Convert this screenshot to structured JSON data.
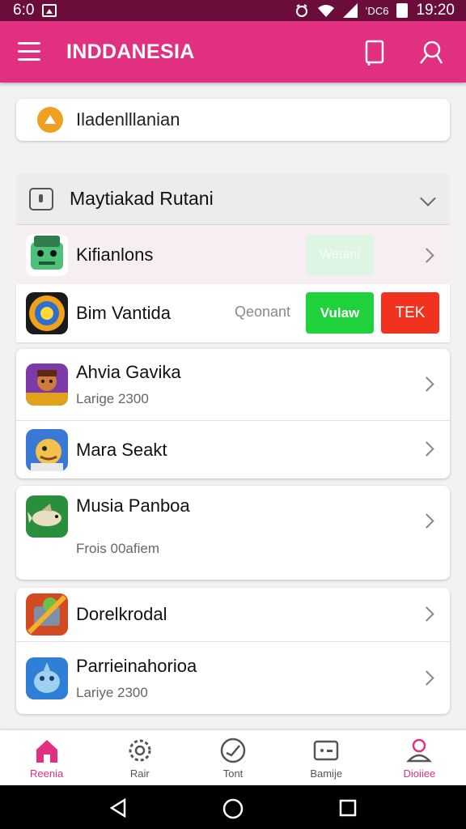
{
  "status_bar": {
    "time_left": "6:0",
    "network": "ʻDC6",
    "time": "19:20"
  },
  "app_bar": {
    "title": "INDDANESIA"
  },
  "search": {
    "text": "Iladenlllanian"
  },
  "section": {
    "title": "Maytiakad Rutani"
  },
  "swipe_rows": [
    {
      "name": "Kifianlons",
      "action": "Wetani"
    },
    {
      "name": "Bim Vantida",
      "swipe_label": "Qeonant",
      "accept": "Vulaw",
      "reject": "TEK"
    }
  ],
  "groups": [
    [
      {
        "name": "Ahvia Gavika",
        "sub": "Larige 2300"
      },
      {
        "name": "Mara Seakt",
        "sub": ""
      }
    ],
    [
      {
        "name": "Musia Panboa",
        "sub": "Frois 00afiem"
      }
    ],
    [
      {
        "name": "Dorelkrodal",
        "sub": ""
      },
      {
        "name": "Parrieinahorioa",
        "sub": "Lariye 2300"
      }
    ]
  ],
  "bottom_nav": [
    {
      "label": "Reenia",
      "icon": "home-icon",
      "active": true
    },
    {
      "label": "Rair",
      "icon": "gear-icon",
      "active": false
    },
    {
      "label": "Tont",
      "icon": "timer-icon",
      "active": false
    },
    {
      "label": "Bamije",
      "icon": "message-icon",
      "active": false
    },
    {
      "label": "Dioiiee",
      "icon": "profile-icon",
      "active": false
    }
  ],
  "colors": {
    "accent": "#e0307f",
    "status_bar": "#6a0d3a",
    "green": "#1fd13a",
    "red": "#f0321e"
  }
}
